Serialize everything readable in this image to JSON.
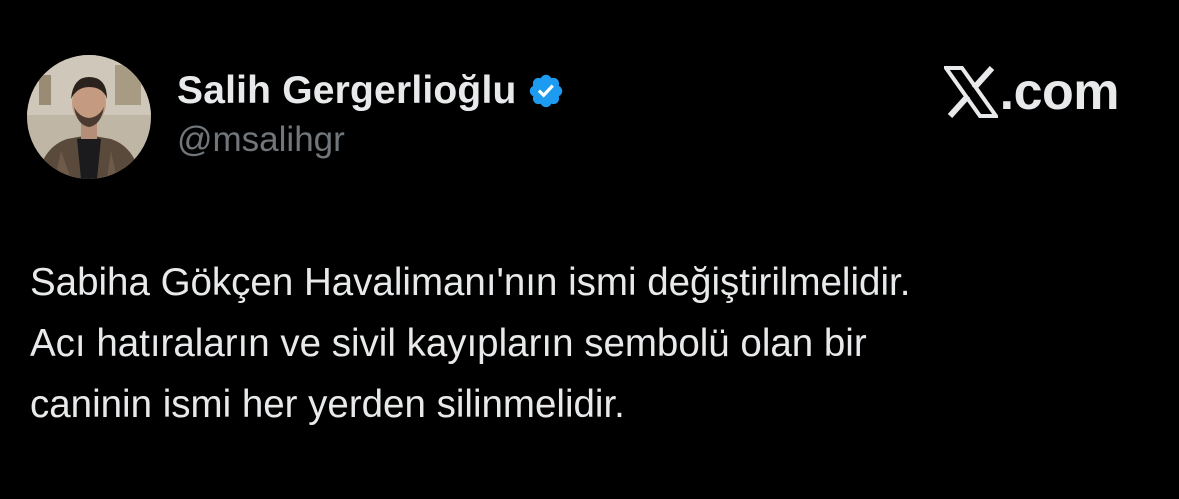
{
  "author": {
    "display_name": "Salih Gergerlioğlu",
    "handle": "@msalihgr",
    "verified": true,
    "verified_color": "#1d9bf0"
  },
  "brand": {
    "text": ".com",
    "icon": "x-logo-icon"
  },
  "tweet": {
    "lines": [
      "Sabiha Gökçen Havalimanı'nın ismi değiştirilmelidir.",
      "Acı hatıraların ve sivil kayıpların sembolü olan bir",
      "caninin ismi her yerden silinmelidir."
    ]
  },
  "colors": {
    "background": "#000000",
    "text_primary": "#e7e9ea",
    "text_secondary": "#71767b"
  }
}
